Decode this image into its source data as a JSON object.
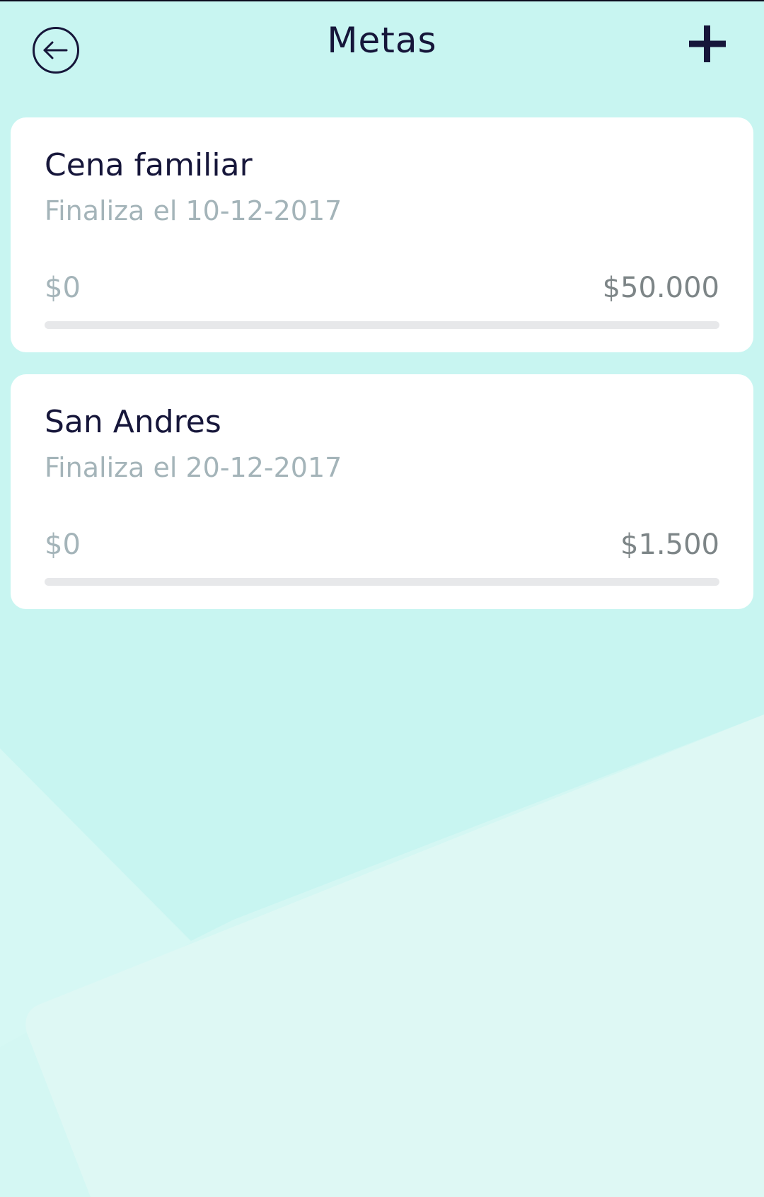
{
  "header": {
    "title": "Metas",
    "back_icon": "arrow-left-circle-icon",
    "add_icon": "plus-icon"
  },
  "goals": [
    {
      "name": "Cena familiar",
      "end_date": "Finaliza el 10-12-2017",
      "current_amount": "$0",
      "target_amount": "$50.000",
      "progress": 0
    },
    {
      "name": "San Andres",
      "end_date": "Finaliza el 20-12-2017",
      "current_amount": "$0",
      "target_amount": "$1.500",
      "progress": 0
    }
  ],
  "colors": {
    "background": "#c8f5f1",
    "background_light": "#def8f4",
    "card": "#ffffff",
    "title_text": "#16163a",
    "secondary_text": "#a4b4b9",
    "progress_track": "#e7e8ea"
  }
}
